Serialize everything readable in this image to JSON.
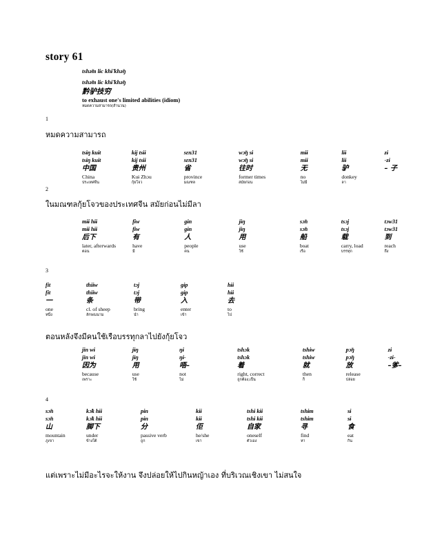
{
  "document": {
    "title": "story 61"
  },
  "idiom": {
    "ipa_tone": "tshə̃m lɨc khɨ̃ khə̃ŋ",
    "ipa_plain": "tshə̃m lɨc khɨ̃ khə̃ŋ",
    "hanzi": "黔驴技穷",
    "english": "to exhaust one's limited abilities (idiom)",
    "thai": "หมดความสามารถ(สำนวน)",
    "linenum": "1"
  },
  "sentences": [
    {
      "linenum": "1",
      "thai_translation": "หมดความสามารถ"
    },
    {
      "linenum": "2",
      "thai_translation": "ในมณฑลกุ้ยโจวของประเทศจีน สมัยก่อนไม่มีลา"
    },
    {
      "linenum": "3",
      "thai_translation": "ตอนหลังจึงมีคนใช้เรือบรรทุกลาไปยังกุ้ยโจว"
    },
    {
      "linenum": "4",
      "thai_translation": "แต่เพราะไม่มีอะไรจะให้งาน จึงปล่อยให้ไปกินหญ้าเอง ที่บริเวณเชิงเขา ไม่สนใจ"
    }
  ],
  "gloss_blocks": [
    {
      "id": "block-1",
      "columns": [
        {
          "ipa1": "tsɨŋ kuɨt",
          "ipa2": "tsɨŋ kuɨt",
          "hanzi": "中国",
          "english": "China",
          "thai": "ประเทศจีน"
        },
        {
          "ipa1": "kɨj tsɨɨ",
          "ipa2": "kɨj tsɨɨ",
          "hanzi": "贵州",
          "english": "Kuɨ Zhɔu",
          "thai": "กุ้ยโจว"
        },
        {
          "ipa1": "sɛn31",
          "ipa2": "sɛn31",
          "hanzi": "省",
          "english": "province",
          "thai": "มณฑล"
        },
        {
          "ipa1": "wɔ̃ŋ sɨ",
          "ipa2": "wɔ̃ŋ sɨ",
          "hanzi": "往时",
          "english": "former times",
          "thai": "สมัยก่อน"
        },
        {
          "ipa1": "mɨɨ",
          "ipa2": "mɨɨ",
          "hanzi": "无",
          "english": "no",
          "thai": "ไม่มี"
        },
        {
          "ipa1": "lɨɨ",
          "ipa2": "lɨɨ",
          "hanzi": "驴",
          "english": "donkey",
          "thai": "ลา"
        },
        {
          "ipa1": "zɨ",
          "ipa2": "-zɨ",
          "hanzi": "– 子",
          "english": "",
          "thai": ""
        }
      ]
    },
    {
      "id": "block-2",
      "columns": [
        {
          "ipa1": "mɨɨ hɨɨ",
          "ipa2": "mɨɨ hɨɨ",
          "hanzi": "后下",
          "english": "later, afterwards",
          "thai": "ตอน"
        },
        {
          "ipa1": "fɨw",
          "ipa2": "fɨw",
          "hanzi": "有",
          "english": "have",
          "thai": "มี"
        },
        {
          "ipa1": "gɨn",
          "ipa2": "gɨn",
          "hanzi": "人",
          "english": "people",
          "thai": "คน"
        },
        {
          "ipa1": "jɨŋ",
          "ipa2": "jɨŋ",
          "hanzi": "用",
          "english": "use",
          "thai": "ใช้"
        },
        {
          "ipa1": "sɔ̃n",
          "ipa2": "sɔ̃n",
          "hanzi": "船",
          "english": "boat",
          "thai": "เรือ"
        },
        {
          "ipa1": "tsɔj",
          "ipa2": "tsɔj",
          "hanzi": "载",
          "english": "carry, load",
          "thai": "บรรทุก"
        },
        {
          "ipa1": "tɔw31",
          "ipa2": "tɔw31",
          "hanzi": "到",
          "english": "reach",
          "thai": "ถึง"
        }
      ]
    },
    {
      "id": "block-3",
      "columns": [
        {
          "ipa1": "fit",
          "ipa2": "fit",
          "hanzi": "一",
          "english": "one",
          "thai": "หนึ่ง"
        },
        {
          "ipa1": "thiɨw",
          "ipa2": "thiɨw",
          "hanzi": "条",
          "english": "cl. of sheep",
          "thai": "ลักษณนาม"
        },
        {
          "ipa1": "tɔj",
          "ipa2": "tɔj",
          "hanzi": "带",
          "english": "bring",
          "thai": "นำ"
        },
        {
          "ipa1": "gɨp",
          "ipa2": "gɨp",
          "hanzi": "入",
          "english": "enter",
          "thai": "เข้า"
        },
        {
          "ipa1": "hɨɨ",
          "ipa2": "hɨɨ",
          "hanzi": "去",
          "english": "to",
          "thai": "ไป"
        }
      ]
    },
    {
      "id": "block-4",
      "columns": [
        {
          "ipa1": "jin wɨ",
          "ipa2": "jin wɨ",
          "hanzi": "因为",
          "english": "because",
          "thai": "เพราะ"
        },
        {
          "ipa1": "jɨŋ",
          "ipa2": "jɨŋ",
          "hanzi": "用",
          "english": "use",
          "thai": "ใช้"
        },
        {
          "ipa1": "ŋɨ",
          "ipa2": "ŋɨ-",
          "hanzi": "唔–",
          "english": "not",
          "thai": "ไม่"
        },
        {
          "ipa1": "tshɔk",
          "ipa2": "tshɔk",
          "hanzi": "着",
          "english": "right, correct",
          "thai": "ถูกต้อง,เป็น"
        },
        {
          "ipa1": "tshɨw",
          "ipa2": "tshɨw",
          "hanzi": "就",
          "english": "then",
          "thai": "ก็"
        },
        {
          "ipa1": "pɔ̃ŋ",
          "ipa2": "pɔ̃ŋ",
          "hanzi": "放",
          "english": "release",
          "thai": "ปล่อย"
        },
        {
          "ipa1": "zɨ",
          "ipa2": "-zɨ-",
          "hanzi": "–爹–",
          "english": "",
          "thai": ""
        }
      ]
    },
    {
      "id": "block-5",
      "columns": [
        {
          "ipa1": "sɔ̃n",
          "ipa2": "sɔ̃n",
          "hanzi": "山",
          "english": "mountain",
          "thai": "ภูเขา"
        },
        {
          "ipa1": "kɔ̃k hɨɨ",
          "ipa2": "kɔ̃k hɨɨ",
          "hanzi": "脚下",
          "english": "under",
          "thai": "ข้างใต้"
        },
        {
          "ipa1": "pɨn",
          "ipa2": "pɨn",
          "hanzi": "分",
          "english": "passive verb",
          "thai": "ถูก"
        },
        {
          "ipa1": "kɨɨ",
          "ipa2": "kɨɨ",
          "hanzi": "佢",
          "english": "he/she",
          "thai": "เขา"
        },
        {
          "ipa1": "tshɨ kɨɨ",
          "ipa2": "tshɨ kɨɨ",
          "hanzi": "自家",
          "english": "oneself",
          "thai": "ตัวเอง"
        },
        {
          "ipa1": "tshɨm",
          "ipa2": "tshɨm",
          "hanzi": "寻",
          "english": "find",
          "thai": "หา"
        },
        {
          "ipa1": "sɨ",
          "ipa2": "sɨ",
          "hanzi": "食",
          "english": "eat",
          "thai": "กิน"
        }
      ]
    }
  ]
}
